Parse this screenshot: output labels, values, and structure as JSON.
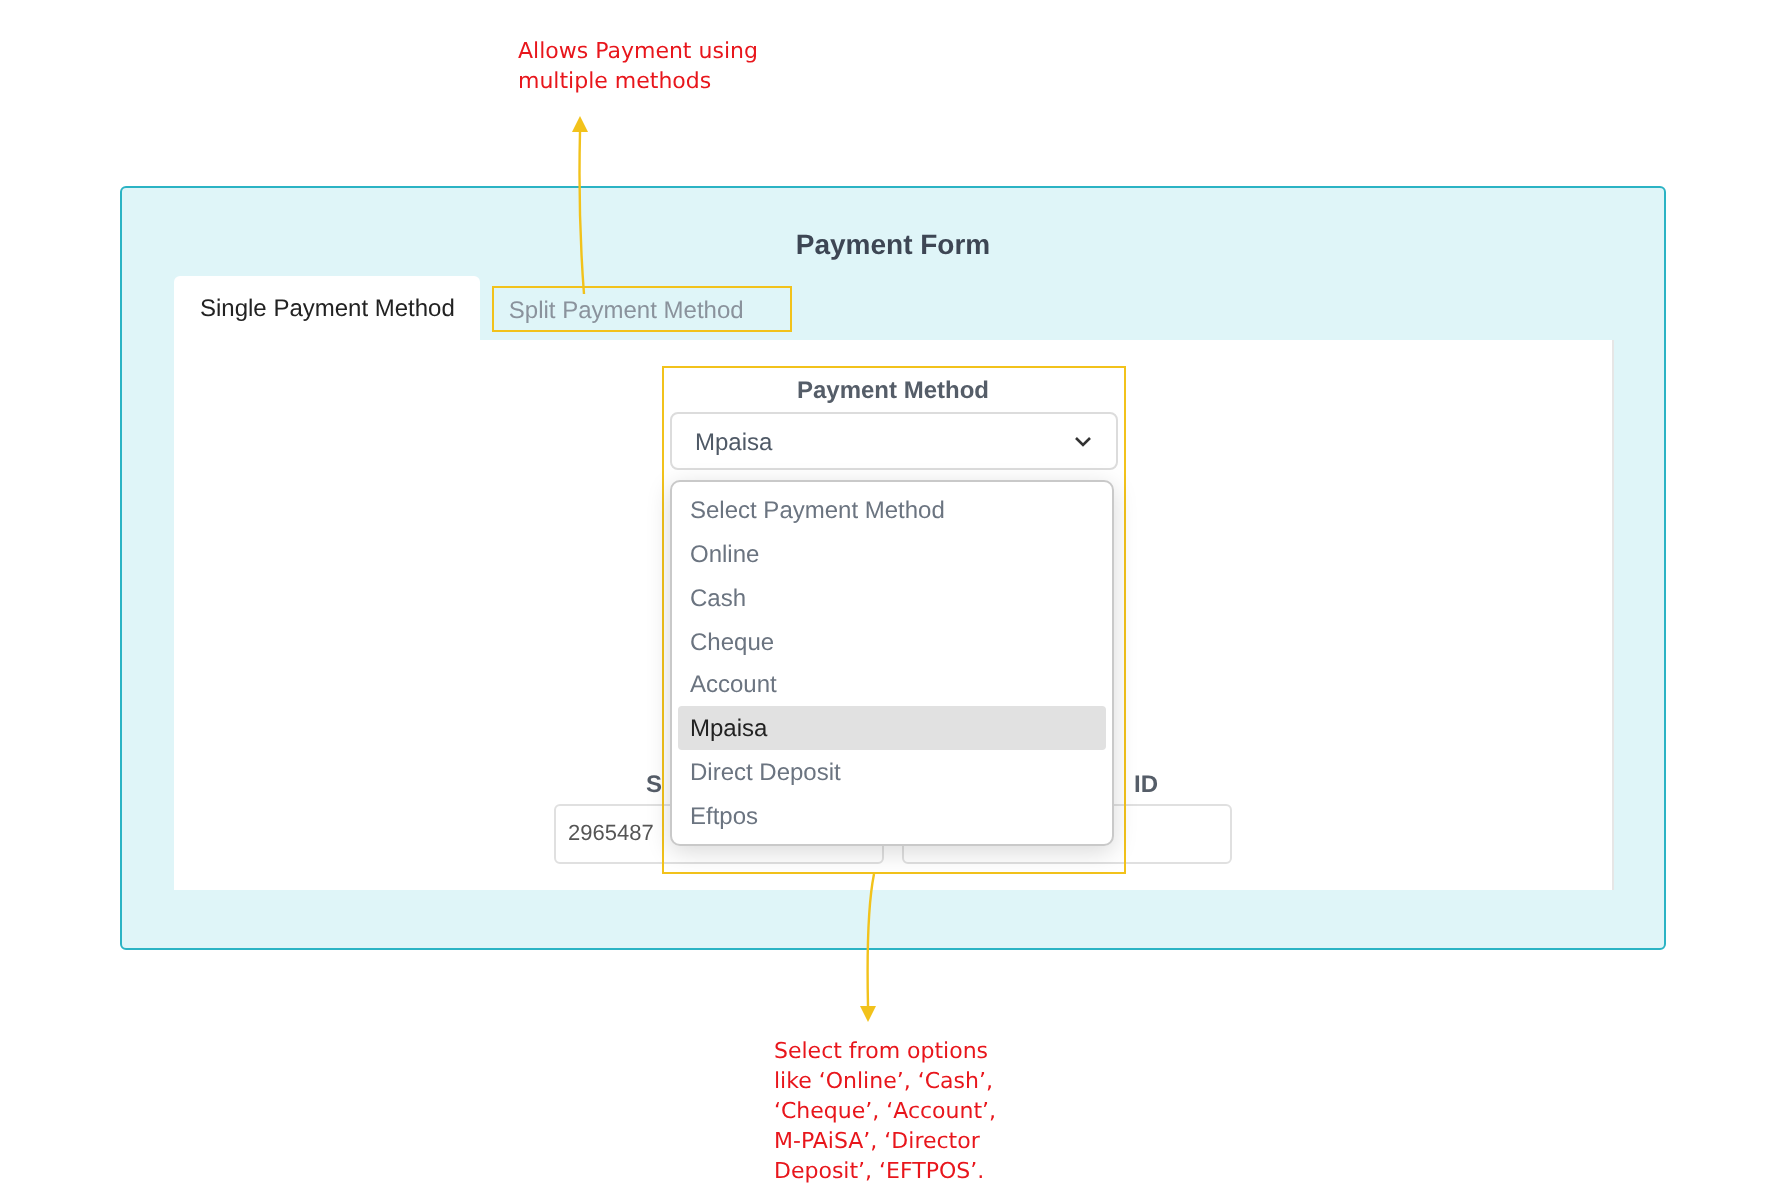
{
  "annotations": [
    {
      "text": "Allows Payment using multiple methods"
    },
    {
      "text": "Select from options like ‘Online’, ‘Cash’, ‘Cheque’, ‘Account’, M-PAiSA’, ‘Director Deposit’, ‘EFTPOS’."
    }
  ],
  "form": {
    "title": "Payment Form",
    "tabs": [
      {
        "label": "Single Payment Method",
        "selected": true
      },
      {
        "label": "Split Payment Method",
        "selected": false
      }
    ],
    "payment_method": {
      "label": "Payment Method",
      "value": "Mpaisa",
      "expanded": true,
      "options": [
        {
          "label": "Select Payment Method",
          "selected": false
        },
        {
          "label": "Online",
          "selected": false
        },
        {
          "label": "Cash",
          "selected": false
        },
        {
          "label": "Cheque",
          "selected": false
        },
        {
          "label": "Account",
          "selected": false
        },
        {
          "label": "Mpaisa",
          "selected": true
        },
        {
          "label": "Direct Deposit",
          "selected": false
        },
        {
          "label": "Eftpos",
          "selected": false
        }
      ]
    },
    "fields": [
      {
        "label": "S",
        "value": "2965487"
      },
      {
        "label": "ID"
      }
    ]
  }
}
